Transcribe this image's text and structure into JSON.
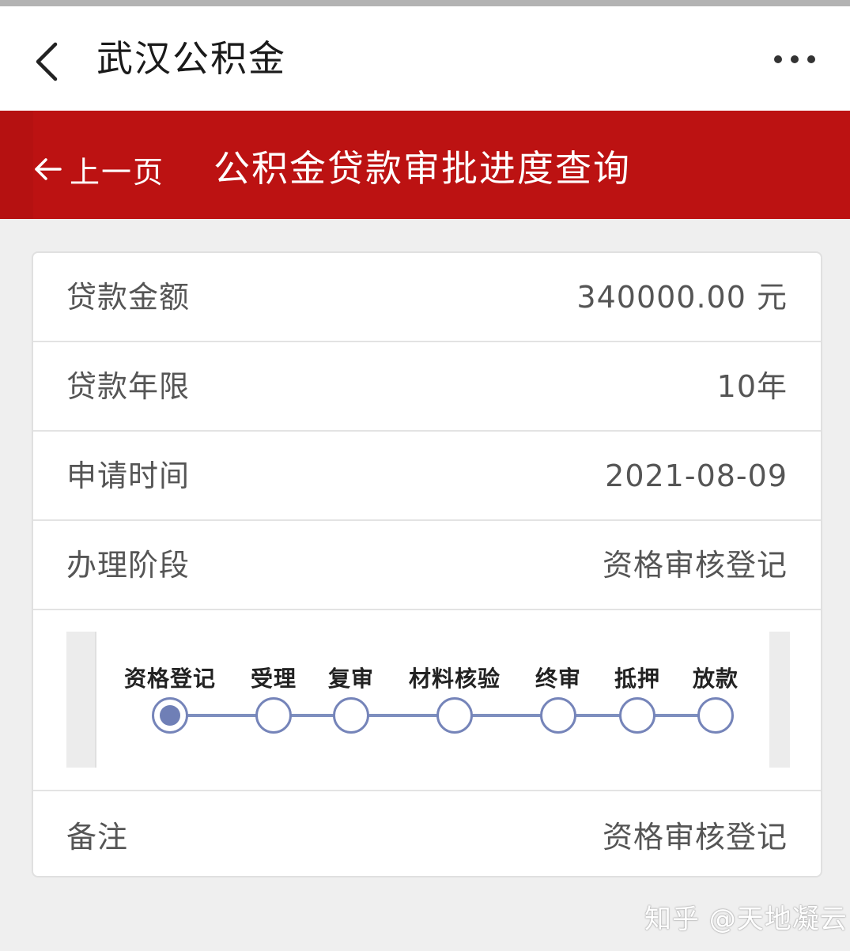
{
  "app_bar": {
    "title": "武汉公积金"
  },
  "header": {
    "back_label": "上一页",
    "title": "公积金贷款审批进度查询"
  },
  "details": [
    {
      "label": "贷款金额",
      "value": "340000.00 元"
    },
    {
      "label": "贷款年限",
      "value": "10年"
    },
    {
      "label": "申请时间",
      "value": "2021-08-09"
    },
    {
      "label": "办理阶段",
      "value": "资格审核登记"
    }
  ],
  "progress": {
    "steps": [
      "资格登记",
      "受理",
      "复审",
      "材料核验",
      "终审",
      "抵押",
      "放款"
    ],
    "current_step": 1
  },
  "remark": {
    "label": "备注",
    "value": "资格审核登记"
  },
  "watermark": "知乎 @天地凝云",
  "colors": {
    "header_red": "#bc1212",
    "progress_accent": "#7584b9",
    "background": "#efefef"
  }
}
